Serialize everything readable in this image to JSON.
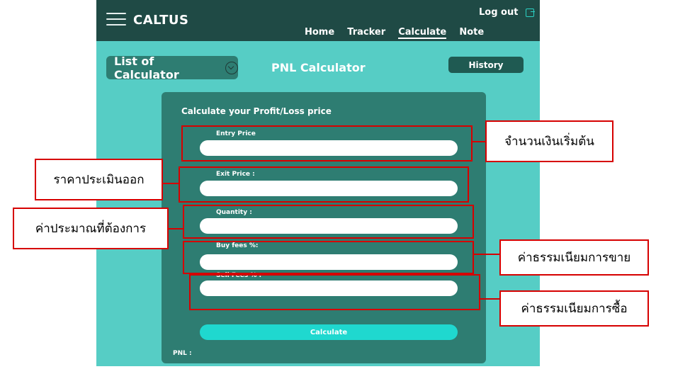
{
  "app": {
    "logo": "CALTUS",
    "logout_label": "Log out",
    "nav": [
      "Home",
      "Tracker",
      "Calculate",
      "Note"
    ],
    "active_nav": "Calculate"
  },
  "toolbar": {
    "list_button": "List of Calculator",
    "page_title": "PNL Calculator",
    "history_button": "History"
  },
  "card": {
    "title": "Calculate your Profit/Loss price",
    "fields": [
      {
        "label": "Entry Price",
        "value": ""
      },
      {
        "label": "Exit Price :",
        "value": ""
      },
      {
        "label": "Quantity :",
        "value": ""
      },
      {
        "label": "Buy fees %:",
        "value": ""
      },
      {
        "label": "Sell Fees % :",
        "value": ""
      }
    ],
    "calculate_label": "Calculate",
    "pnl_label": "PNL :"
  },
  "annotations": {
    "entry": "จำนวนเงินเริ่มต้น",
    "exit": "ราคาประเมินออก",
    "quantity": "ค่าประมาณที่ต้องการ",
    "buy_fees": "ค่าธรรมเนียมการขาย",
    "sell_fees": "ค่าธรรมเนียมการซื้อ"
  },
  "colors": {
    "background": "#56cdc5",
    "topbar": "#1f4a45",
    "card": "#2e7d72",
    "button_accent": "#1fd8cf",
    "annotation": "#d60000"
  }
}
